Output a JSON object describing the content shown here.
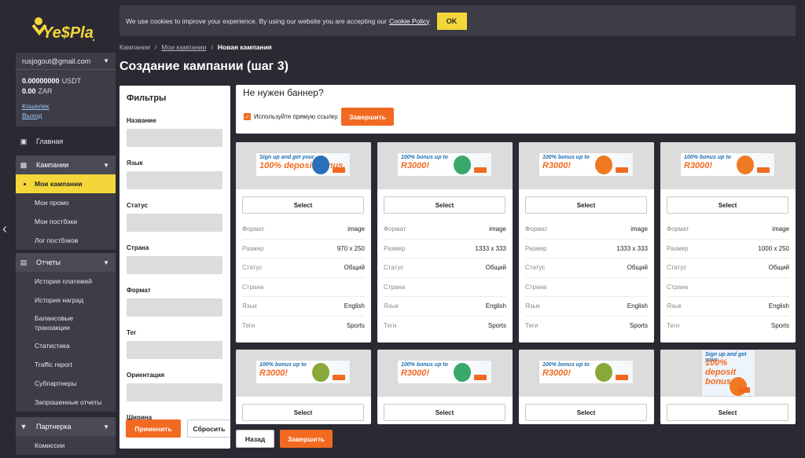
{
  "logo_text": "Ye$Play",
  "account": {
    "email": "rusjogout@gmail.com",
    "balances": [
      {
        "amount": "0.00000000",
        "currency": "USDT"
      },
      {
        "amount": "0.00",
        "currency": "ZAR"
      }
    ],
    "links": [
      "Кошелек",
      "Выход"
    ]
  },
  "nav": {
    "home": "Главная",
    "campaigns": {
      "title": "Кампании",
      "items": [
        "Мои кампании",
        "Мои промо",
        "Мои постбэки",
        "Лог постбэков"
      ]
    },
    "reports": {
      "title": "Отчеты",
      "items": [
        "История платежей",
        "История наград",
        "Балансовые транзакции",
        "Статистика",
        "Traffic report",
        "Субпартнеры",
        "Запрошенные отчеты"
      ]
    },
    "partners": {
      "title": "Партнерка",
      "items": [
        "Комиссии"
      ]
    }
  },
  "cookie": {
    "text": "We use cookies to improve your experience. By using our website you are accepting our",
    "link": "Cookie Policy",
    "ok": "OK"
  },
  "breadcrumb": [
    "Кампании",
    "Мои кампании",
    "Новая кампания"
  ],
  "page_title": "Создание кампании (шаг 3)",
  "filters": {
    "title": "Фильтры",
    "fields": [
      "Название",
      "Язык",
      "Статус",
      "Страна",
      "Формат",
      "Тег",
      "Ориентация",
      "Ширина"
    ],
    "apply": "Применить",
    "reset": "Сбросить"
  },
  "no_banner": {
    "title": "Не нужен баннер?",
    "checkbox_label": "Используйте прямую ссылку.",
    "finish": "Завершить"
  },
  "row_labels": [
    "Формат",
    "Размер",
    "Статус",
    "Страна",
    "Язык",
    "Теги"
  ],
  "select_label": "Select",
  "banner_texts": {
    "a": {
      "top": "Sign up and get your",
      "amount": "100% deposit bonus."
    },
    "b": {
      "top": "100% bonus up to",
      "amount": "R3000!"
    },
    "c": {
      "top": "Sign up and get your",
      "amount": "100% deposit bonus."
    }
  },
  "cards": [
    {
      "banner": "a",
      "art_color": "#2a6fb8",
      "values": [
        "image",
        "970 x 250",
        "Общий",
        "",
        "English",
        "Sports"
      ]
    },
    {
      "banner": "b",
      "art_color": "#3aa86b",
      "values": [
        "image",
        "1333 x 333",
        "Общий",
        "",
        "English",
        "Sports"
      ]
    },
    {
      "banner": "b",
      "art_color": "#f07a22",
      "values": [
        "image",
        "1333 x 333",
        "Общий",
        "",
        "English",
        "Sports"
      ]
    },
    {
      "banner": "b",
      "art_color": "#f07a22",
      "values": [
        "image",
        "1000 x 250",
        "Общий",
        "",
        "English",
        "Sports"
      ]
    },
    {
      "banner": "b",
      "art_color": "#8aa83a",
      "values": []
    },
    {
      "banner": "b",
      "art_color": "#3aa86b",
      "values": []
    },
    {
      "banner": "b",
      "art_color": "#8aa83a",
      "values": []
    },
    {
      "banner": "c",
      "art_color": "#f07a22",
      "values": []
    }
  ],
  "bottom": {
    "back": "Назад",
    "finish": "Завершить"
  }
}
